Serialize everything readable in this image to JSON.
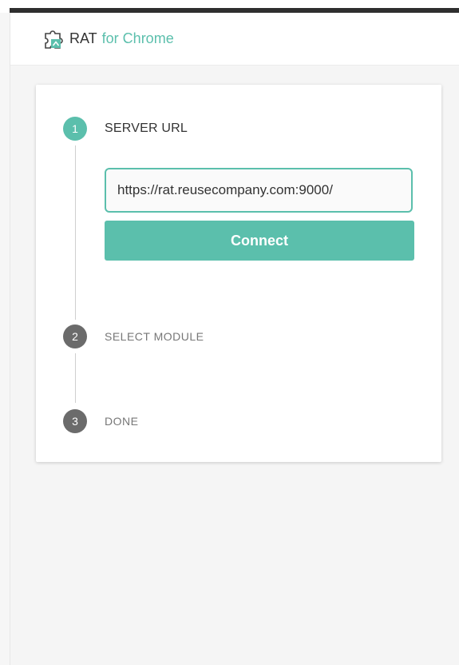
{
  "header": {
    "app_name": "RAT",
    "subtitle": "for Chrome",
    "logo_icon": "puzzle-piece-icon"
  },
  "steps": [
    {
      "number": "1",
      "label": "SERVER URL",
      "state": "active"
    },
    {
      "number": "2",
      "label": "SELECT MODULE",
      "state": "inactive"
    },
    {
      "number": "3",
      "label": "DONE",
      "state": "inactive"
    }
  ],
  "server_url": {
    "value": "https://rat.reusecompany.com:9000/"
  },
  "connect_button": {
    "label": "Connect"
  },
  "colors": {
    "accent": "#5bbfac",
    "inactive_step": "#6b6b6b"
  }
}
